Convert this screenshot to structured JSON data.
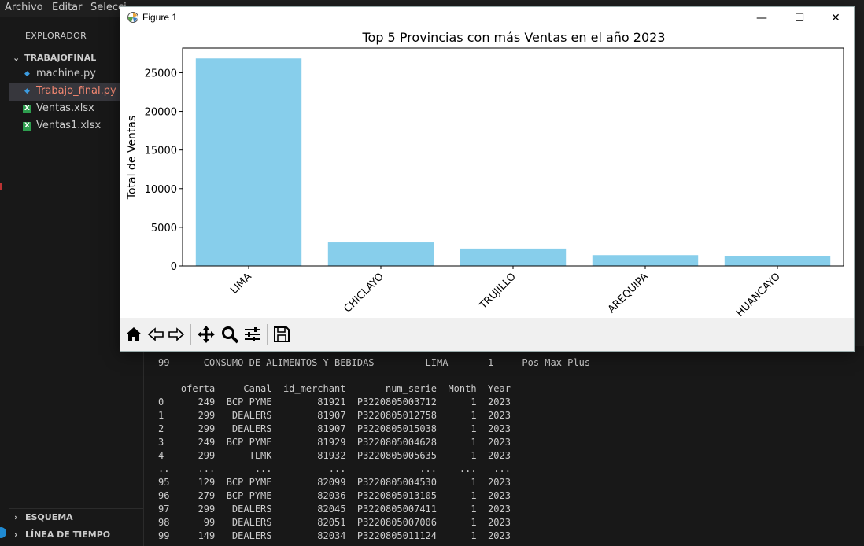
{
  "menubar": {
    "items": [
      "Archivo",
      "Editar",
      "Selecci"
    ]
  },
  "explorer": {
    "title": "EXPLORADOR",
    "folder": "TRABAJOFINAL",
    "files": [
      {
        "name": "machine.py",
        "icon": "python-icon",
        "color": "#cccccc"
      },
      {
        "name": "Trabajo_final.py",
        "icon": "python-icon",
        "color": "#f48771"
      },
      {
        "name": "Ventas.xlsx",
        "icon": "excel-icon",
        "color": "#cccccc"
      },
      {
        "name": "Ventas1.xlsx",
        "icon": "excel-icon",
        "color": "#cccccc"
      }
    ],
    "outline": "ESQUEMA",
    "timeline": "LÍNEA DE TIEMPO"
  },
  "figure": {
    "window_title": "Figure 1",
    "toolbar": [
      "home-icon",
      "back-icon",
      "forward-icon",
      "pan-icon",
      "zoom-icon",
      "configure-icon",
      "save-icon"
    ]
  },
  "chart_data": {
    "type": "bar",
    "title": "Top 5 Provincias con más Ventas en el año 2023",
    "xlabel": "",
    "ylabel": "Total de Ventas",
    "categories": [
      "LIMA",
      "CHICLAYO",
      "TRUJILLO",
      "AREQUIPA",
      "HUANCAYO"
    ],
    "values": [
      26850,
      3050,
      2250,
      1400,
      1300
    ],
    "ylim": [
      0,
      28200
    ],
    "yticks": [
      0,
      5000,
      10000,
      15000,
      20000,
      25000
    ],
    "bar_color": "#87ceeb",
    "grid": false
  },
  "terminal": {
    "lines": [
      "99      CONSUMO DE ALIMENTOS Y BEBIDAS         LIMA       1     Pos Max Plus",
      "",
      "    oferta     Canal  id_merchant       num_serie  Month  Year",
      "0      249  BCP PYME        81921  P3220805003712      1  2023",
      "1      299   DEALERS        81907  P3220805012758      1  2023",
      "2      299   DEALERS        81907  P3220805015038      1  2023",
      "3      249  BCP PYME        81929  P3220805004628      1  2023",
      "4      299      TLMK        81932  P3220805005635      1  2023",
      "..     ...       ...          ...             ...    ...   ...",
      "95     129  BCP PYME        82099  P3220805004530      1  2023",
      "96     279  BCP PYME        82036  P3220805013105      1  2023",
      "97     299   DEALERS        82045  P3220805007411      1  2023",
      "98      99   DEALERS        82051  P3220805007006      1  2023",
      "99     149   DEALERS        82034  P3220805011124      1  2023"
    ]
  }
}
